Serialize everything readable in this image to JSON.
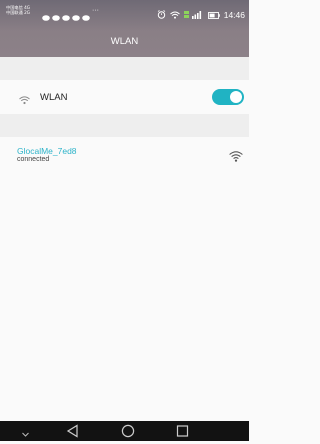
{
  "status_bar": {
    "carrier_line1": "中国电信 4G",
    "carrier_line2": "中国联通 2G",
    "overflow": "···",
    "time": "14:46"
  },
  "header": {
    "title": "WLAN"
  },
  "wlan_toggle": {
    "label": "WLAN",
    "enabled": true,
    "accent": "#20b3c3"
  },
  "networks": [
    {
      "ssid": "GlocalMe_7ed8",
      "status": "connected",
      "color": "#2cb3c9"
    }
  ],
  "nav_bar": {
    "icons": [
      "chevron-down-icon",
      "back-icon",
      "home-icon",
      "recents-icon"
    ]
  }
}
